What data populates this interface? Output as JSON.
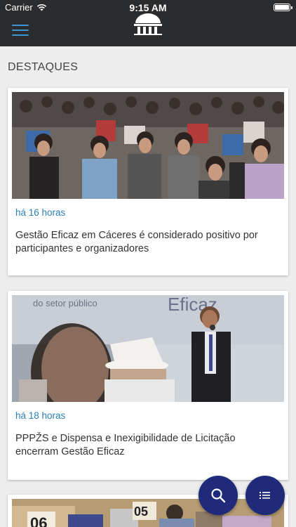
{
  "status_bar": {
    "carrier": "Carrier",
    "time": "9:15 AM"
  },
  "header": {
    "menu_icon": "hamburger-menu-icon",
    "logo_icon": "tribunal-building-logo"
  },
  "section": {
    "title": "DESTAQUES"
  },
  "articles": [
    {
      "time": "há 16 horas",
      "title": "Gestão Eficaz em Cáceres é considerado positivo por participantes e organizadores"
    },
    {
      "time": "há 18 horas",
      "title": "PPPŽS e Dispensa e Inexigibilidade de Licitação encerram Gestão Eficaz"
    },
    {
      "time": "",
      "title": ""
    }
  ],
  "photo_text": {
    "banner_word": "Eficaz",
    "banner_left": "do setor público",
    "card3_numbers": [
      "06",
      "05"
    ]
  },
  "fabs": {
    "search_icon": "search-icon",
    "list_icon": "list-icon"
  },
  "colors": {
    "topbar": "#2b2c2e",
    "accent_blue": "#3a97d4",
    "time_blue": "#2a7fb8",
    "fab": "#1f2a7a",
    "background": "#ededed"
  }
}
